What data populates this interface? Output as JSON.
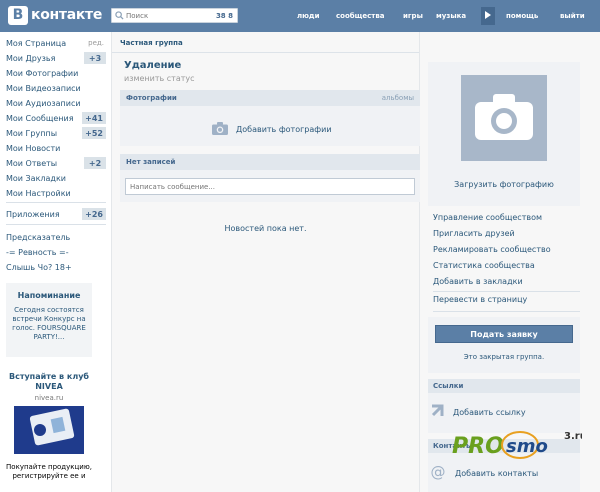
{
  "header": {
    "logo_letter": "В",
    "logo_text": "контакте",
    "search": {
      "placeholder": "Поиск",
      "count": "38 8"
    },
    "nav": [
      "люди",
      "сообщества",
      "игры",
      "музыка",
      "помощь",
      "выйти"
    ]
  },
  "sidebar": {
    "items": [
      {
        "label": "Моя Страница",
        "extra": "ред."
      },
      {
        "label": "Мои Друзья",
        "badge": "+3"
      },
      {
        "label": "Мои Фотографии"
      },
      {
        "label": "Мои Видеозаписи"
      },
      {
        "label": "Мои Аудиозаписи"
      },
      {
        "label": "Мои Сообщения",
        "badge": "+41"
      },
      {
        "label": "Мои Группы",
        "badge": "+52"
      },
      {
        "label": "Мои Новости"
      },
      {
        "label": "Мои Ответы",
        "badge": "+2"
      },
      {
        "label": "Мои Закладки"
      },
      {
        "label": "Мои Настройки"
      }
    ],
    "apps": {
      "label": "Приложения",
      "badge": "+26"
    },
    "links": [
      "Предсказатель",
      "-= Ревность =-",
      "Слышь Чо? 18+"
    ],
    "reminder": {
      "title": "Напоминание",
      "body": "Сегодня состоятся встречи Конкурс на голос. FOURSQUARE PARTY!..."
    },
    "ad": {
      "title": "Вступайте в клуб NIVEA",
      "domain": "nivea.ru",
      "text": "Покупайте продукцию, регистрируйте ее и"
    }
  },
  "main": {
    "breadcrumb": "Частная группа",
    "title": "Удаление",
    "status": "изменить статус",
    "photos": {
      "header": "Фотографии",
      "albums_link": "альбомы",
      "add_label": "Добавить фотографии"
    },
    "wall": {
      "header": "Нет записей",
      "placeholder": "Написать сообщение..."
    },
    "no_news": "Новостей пока нет."
  },
  "right": {
    "upload_label": "Загрузить фотографию",
    "links": [
      "Управление сообществом",
      "Пригласить друзей",
      "Рекламировать сообщество",
      "Статистика сообщества",
      "Добавить в закладки"
    ],
    "translate_link": "Перевести в страницу",
    "apply_button": "Подать заявку",
    "closed_note": "Это закрытая группа.",
    "links_block": {
      "header": "Ссылки",
      "action": "Добавить ссылку"
    },
    "contacts_block": {
      "header": "Контакты",
      "action": "Добавить контакты"
    }
  },
  "watermark": {
    "text_a": "PRO",
    "text_b": "smo",
    "suffix": "3.ru"
  },
  "colors": {
    "header_bg": "#5b7fa6",
    "link": "#2b587a",
    "block_header": "#e1e7ed",
    "badge_bg": "#dae2e8"
  }
}
